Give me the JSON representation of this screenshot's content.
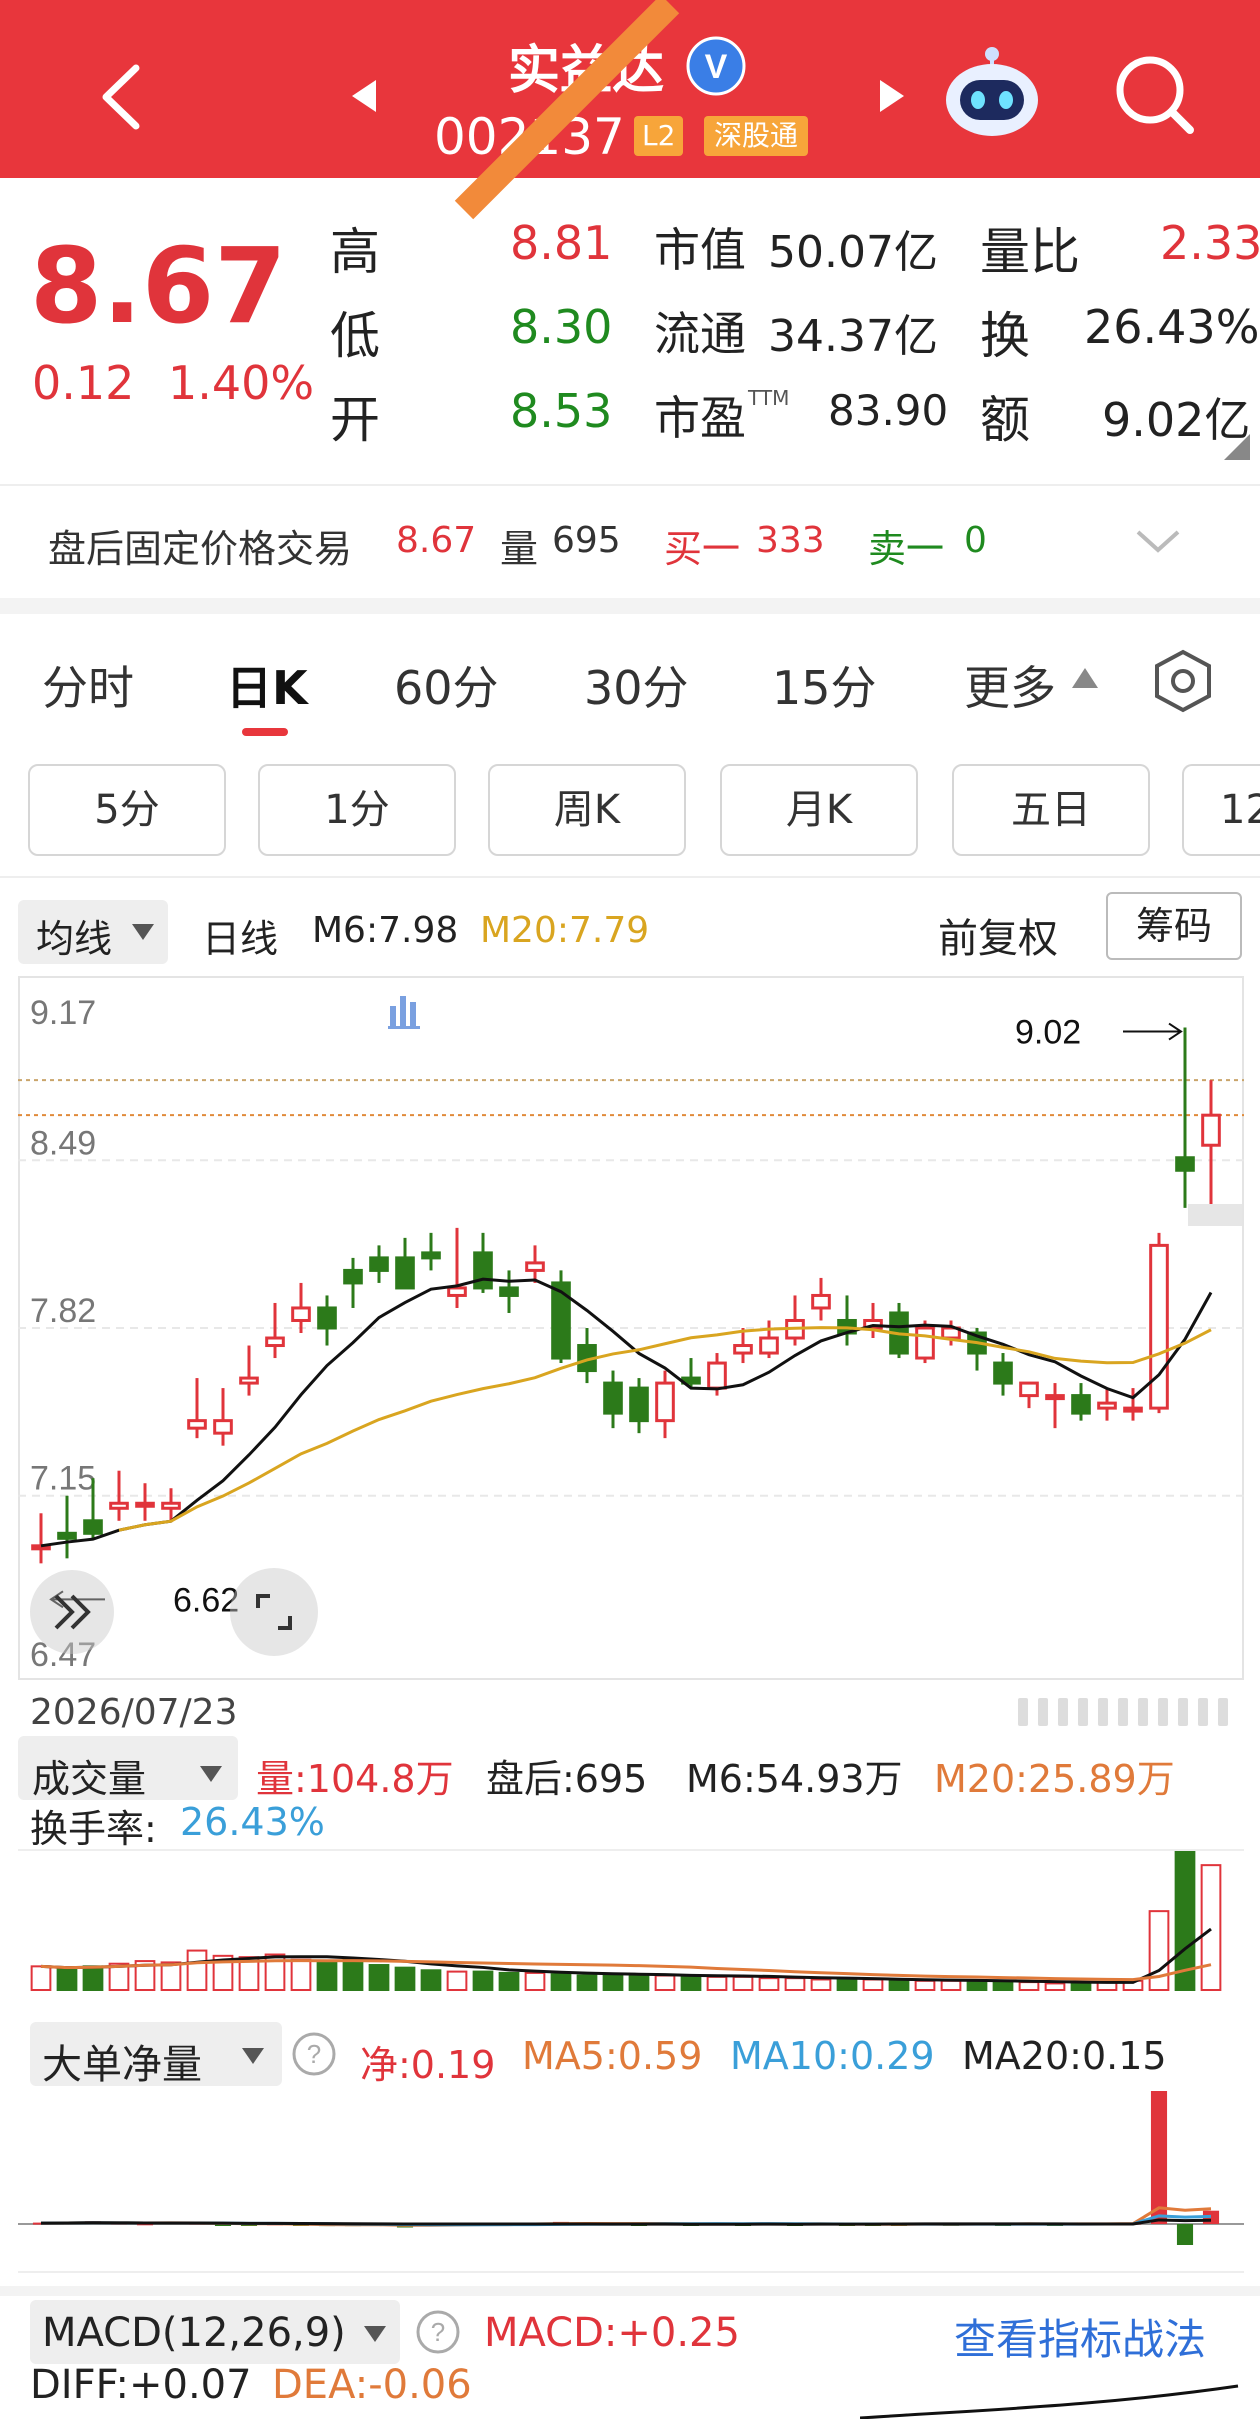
{
  "header": {
    "title": "实益达",
    "code": "002137",
    "badge_l2": "L2",
    "badge_connect": "深股通"
  },
  "quote": {
    "price": "8.67",
    "change": "0.12",
    "change_pct": "1.40%",
    "high_label": "高",
    "high": "8.81",
    "low_label": "低",
    "low": "8.30",
    "open_label": "开",
    "open": "8.53",
    "mcap_label": "市值",
    "mcap": "50.07亿",
    "float_label": "流通",
    "float": "34.37亿",
    "pe_label": "市盈",
    "pe_sup": "TTM",
    "pe": "83.90",
    "vr_label": "量比",
    "vr": "2.33",
    "turn_label": "换",
    "turn": "26.43%",
    "amt_label": "额",
    "amt": "9.02亿"
  },
  "afterhours": {
    "label": "盘后固定价格交易",
    "price": "8.67",
    "vol_label": "量",
    "vol": "695",
    "buy_label": "买一",
    "buy": "333",
    "sell_label": "卖一",
    "sell": "0"
  },
  "tabs": [
    {
      "label": "分时"
    },
    {
      "label": "日K"
    },
    {
      "label": "60分"
    },
    {
      "label": "30分"
    },
    {
      "label": "15分"
    },
    {
      "label": "更多"
    }
  ],
  "subtabs": [
    "5分",
    "1分",
    "周K",
    "月K",
    "五日",
    "12"
  ],
  "kline": {
    "ma_selector": "均线",
    "period": "日线",
    "m6": "M6:7.98",
    "m20": "M20:7.79",
    "adjust": "前复权",
    "chips": "筹码",
    "y_labels": [
      "9.17",
      "8.49",
      "7.82",
      "7.15",
      "6.47"
    ],
    "max_label": "9.02",
    "min_label": "6.62",
    "date": "2026/07/23"
  },
  "volume": {
    "selector": "成交量",
    "vol": "量:104.8万",
    "after": "盘后:695",
    "m6": "M6:54.93万",
    "m20": "M20:25.89万",
    "turn_label": "换手率:",
    "turn": "26.43%"
  },
  "bigorder": {
    "selector": "大单净量",
    "net": "净:0.19",
    "ma5": "MA5:0.59",
    "ma10": "MA10:0.29",
    "ma20": "MA20:0.15"
  },
  "macd": {
    "selector": "MACD(12,26,9)",
    "macd": "MACD:+0.25",
    "link": "查看指标战法",
    "diff": "DIFF:+0.07",
    "dea": "DEA:-0.06"
  },
  "colors": {
    "up": "#e0343b",
    "down": "#2c7a1a",
    "ma20": "#d9a520",
    "ma6": "#111111",
    "accent": "#e8363c"
  },
  "chart_data": [
    {
      "type": "candlestick",
      "title": "日K",
      "y_range": [
        6.47,
        9.17
      ],
      "series": [
        {
          "name": "K",
          "values": [
            [
              6.95,
              7.08,
              6.95,
              6.88
            ],
            [
              7.0,
              7.15,
              6.98,
              6.9
            ],
            [
              7.05,
              7.22,
              7.0,
              6.98
            ],
            [
              7.1,
              7.25,
              7.12,
              7.05
            ],
            [
              7.12,
              7.2,
              7.12,
              7.05
            ],
            [
              7.1,
              7.18,
              7.12,
              7.05
            ],
            [
              7.42,
              7.62,
              7.45,
              7.38
            ],
            [
              7.4,
              7.58,
              7.45,
              7.35
            ],
            [
              7.6,
              7.75,
              7.62,
              7.55
            ],
            [
              7.75,
              7.92,
              7.78,
              7.7
            ],
            [
              7.85,
              8.0,
              7.9,
              7.8
            ],
            [
              7.9,
              7.95,
              7.82,
              7.75
            ],
            [
              8.05,
              8.1,
              8.0,
              7.9
            ],
            [
              8.1,
              8.15,
              8.05,
              8.0
            ],
            [
              8.1,
              8.18,
              7.98,
              7.98
            ],
            [
              8.12,
              8.2,
              8.1,
              8.05
            ],
            [
              7.95,
              8.22,
              7.98,
              7.9
            ],
            [
              8.12,
              8.2,
              7.98,
              7.96
            ],
            [
              7.98,
              8.05,
              7.95,
              7.88
            ],
            [
              8.05,
              8.15,
              8.08,
              8.0
            ],
            [
              8.0,
              8.05,
              7.7,
              7.68
            ],
            [
              7.75,
              7.82,
              7.65,
              7.6
            ],
            [
              7.6,
              7.65,
              7.48,
              7.42
            ],
            [
              7.58,
              7.62,
              7.45,
              7.4
            ],
            [
              7.45,
              7.65,
              7.6,
              7.38
            ],
            [
              7.62,
              7.7,
              7.6,
              7.58
            ],
            [
              7.58,
              7.72,
              7.68,
              7.55
            ],
            [
              7.72,
              7.82,
              7.75,
              7.68
            ],
            [
              7.72,
              7.85,
              7.78,
              7.7
            ],
            [
              7.78,
              7.95,
              7.85,
              7.75
            ],
            [
              7.9,
              8.02,
              7.95,
              7.85
            ],
            [
              7.85,
              7.95,
              7.8,
              7.75
            ],
            [
              7.82,
              7.92,
              7.85,
              7.78
            ],
            [
              7.88,
              7.92,
              7.72,
              7.7
            ],
            [
              7.7,
              7.85,
              7.82,
              7.68
            ],
            [
              7.78,
              7.85,
              7.82,
              7.75
            ],
            [
              7.8,
              7.82,
              7.72,
              7.65
            ],
            [
              7.68,
              7.72,
              7.6,
              7.55
            ],
            [
              7.55,
              7.6,
              7.6,
              7.5
            ],
            [
              7.55,
              7.6,
              7.55,
              7.42
            ],
            [
              7.55,
              7.6,
              7.48,
              7.45
            ],
            [
              7.5,
              7.58,
              7.52,
              7.45
            ],
            [
              7.5,
              7.58,
              7.5,
              7.45
            ],
            [
              7.5,
              8.2,
              8.15,
              7.48
            ],
            [
              8.5,
              9.02,
              8.45,
              8.3
            ],
            [
              8.55,
              8.81,
              8.67,
              8.3
            ]
          ]
        }
      ]
    },
    {
      "type": "bar",
      "title": "成交量",
      "series": [
        {
          "name": "量",
          "values": [
            18,
            16,
            18,
            20,
            22,
            21,
            30,
            26,
            25,
            27,
            23,
            21,
            24,
            19,
            17,
            15,
            14,
            14,
            13,
            13,
            12,
            11,
            11,
            12,
            11,
            10,
            10,
            10,
            9,
            9,
            8,
            8,
            8,
            7,
            7,
            7,
            7,
            6,
            6,
            5,
            5,
            6,
            7,
            60,
            105,
            95
          ]
        }
      ]
    },
    {
      "type": "bar",
      "title": "大单净量",
      "series": [
        {
          "name": "净",
          "values": [
            0.02,
            0.03,
            0.04,
            0.02,
            0.01,
            0.03,
            0.02,
            -0.01,
            -0.02,
            0.01,
            -0.02,
            -0.03,
            -0.03,
            -0.02,
            -0.05,
            -0.02,
            0.0,
            0.01,
            -0.01,
            0.02,
            0.03,
            0.01,
            0.01,
            -0.01,
            0.02,
            -0.01,
            0.01,
            -0.01,
            0.02,
            -0.01,
            0.01,
            -0.02,
            -0.01,
            -0.01,
            0.01,
            -0.01,
            0.01,
            -0.01,
            0.01,
            -0.01,
            0.01,
            0.01,
            0.02,
            1.9,
            -0.3,
            0.19
          ]
        }
      ]
    }
  ]
}
